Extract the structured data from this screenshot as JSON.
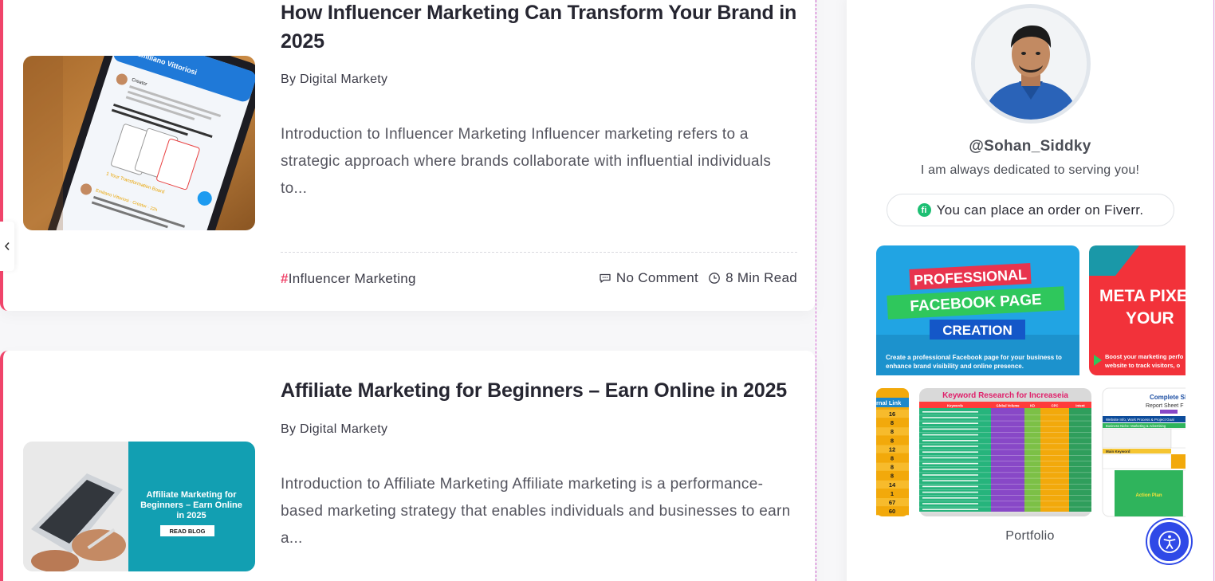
{
  "posts": [
    {
      "title": "How Influencer Marketing Can Transform Your Brand in 2025",
      "author": "By Digital Markety",
      "excerpt": "Introduction to Influencer Marketing Influencer marketing refers to a strategic approach where brands collaborate with influential individuals to...",
      "tag_hash": "#",
      "tag": "Influencer Marketing",
      "comments": "No Comment",
      "read_time": "8 Min Read",
      "image_text": {
        "name": "Emiliano Vittoriosi",
        "handle": "Creator",
        "tweet": "Transforming your life starts with a single step. And the Transformation Board can help guide you on that path.",
        "question": "What are some initial steps you plan to take with this product?",
        "footer": "1 Your Transformation Board",
        "reply_name": "Emiliano Vittoriosi · Creator · 22h",
        "reply_text": "Introducing SWIPE: The Morning Methodology That Will Change You"
      }
    },
    {
      "title": "Affiliate Marketing for Beginners – Earn Online in 2025",
      "author": "By Digital Markety",
      "excerpt": "Introduction to Affiliate Marketing Affiliate marketing is a performance-based marketing strategy that enables individuals and businesses to earn a...",
      "image_text": {
        "headline": "Affiliate Marketing for Beginners – Earn Online in 2025",
        "cta": "READ BLOG"
      }
    }
  ],
  "sidebar": {
    "username": "@Sohan_Siddky",
    "tagline": "I am always dedicated to serving you!",
    "fiverr_icon": "fi",
    "fiverr_label": "You can place an order on Fiverr.",
    "portfolio_label": "Portfolio",
    "gallery": {
      "fb_line1": "PROFESSIONAL",
      "fb_line2": "FACEBOOK PAGE",
      "fb_line3": "CREATION",
      "fb_desc1": "Create a professional Facebook page for your business to",
      "fb_desc2": "enhance brand visibility and online presence.",
      "meta_line1": "META PIXE",
      "meta_line2": "YOUR",
      "meta_desc1": "Boost your marketing perfo",
      "meta_desc2": "website to track visitors, o",
      "link_header": "rnal Link",
      "link_values": [
        "16",
        "8",
        "8",
        "8",
        "12",
        "8",
        "8",
        "8",
        "14",
        "1",
        "67",
        "60"
      ],
      "kw_title": "Keyword Research for Increaseia",
      "kw_headers": [
        "Keywords",
        "Global Volume",
        "KD",
        "CPC",
        "Intent"
      ],
      "seo_title1": "Complete SEO",
      "seo_title2": "Report Sheet F",
      "seo_section1": "Website Info, Work Process & Project Goal",
      "seo_section2": "Business Niche: Marketing & Advertising",
      "seo_row_main": "Main Keyword",
      "seo_action": "Action Plan"
    }
  },
  "colors": {
    "accent": "#f0446a",
    "fiverr": "#1dbf73",
    "accessibility": "#2f49e7"
  },
  "icons": {
    "collapse": "chevron-left-icon",
    "comment": "comment-icon",
    "clock": "clock-icon",
    "accessibility": "accessibility-icon"
  }
}
